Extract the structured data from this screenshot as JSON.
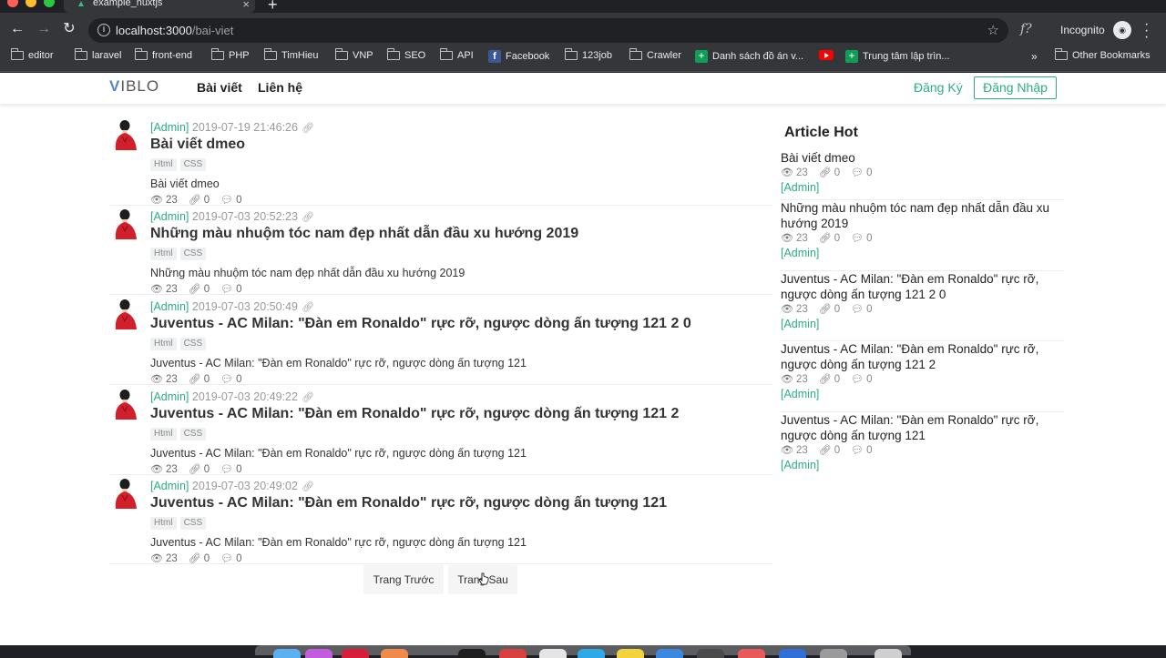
{
  "browser": {
    "tab_title": "example_nuxtjs",
    "url_host": "localhost:3000",
    "url_path": "/bai-viet",
    "profile_label": "Incognito",
    "extension_label": "f?",
    "bookmarks": [
      {
        "label": "editor",
        "icon": "folder-icon"
      },
      {
        "label": "laravel",
        "icon": "folder-icon"
      },
      {
        "label": "front-end",
        "icon": "folder-icon"
      },
      {
        "label": "PHP",
        "icon": "folder-icon"
      },
      {
        "label": "TimHieu",
        "icon": "folder-icon"
      },
      {
        "label": "VNP",
        "icon": "folder-icon"
      },
      {
        "label": "SEO",
        "icon": "folder-icon"
      },
      {
        "label": "API",
        "icon": "folder-icon"
      },
      {
        "label": "Facebook",
        "icon": "facebook-icon"
      },
      {
        "label": "123job",
        "icon": "folder-icon"
      },
      {
        "label": "Crawler",
        "icon": "folder-icon"
      },
      {
        "label": "Danh sách đồ án v...",
        "icon": "sheets-icon"
      },
      {
        "label": "",
        "icon": "youtube-icon"
      },
      {
        "label": "Trung tâm lập trìn...",
        "icon": "sheets-icon"
      }
    ],
    "more_label": "»",
    "other_bookmarks": "Other Bookmarks"
  },
  "site": {
    "logo": "VIBLO",
    "nav": [
      "Bài viết",
      "Liên hệ"
    ],
    "signup": "Đăng Ký",
    "login": "Đăng Nhập",
    "brand_color": "#2bae82"
  },
  "posts": [
    {
      "author": "[Admin]",
      "date": "2019-07-19 21:46:26",
      "title": "Bài viết dmeo",
      "tags": [
        "Html",
        "CSS"
      ],
      "excerpt": "Bài viết dmeo",
      "views": "23",
      "clips": "0",
      "comments": "0"
    },
    {
      "author": "[Admin]",
      "date": "2019-07-03 20:52:23",
      "title": "Những màu nhuộm tóc nam đẹp nhất dẫn đầu xu hướng 2019",
      "tags": [
        "Html",
        "CSS"
      ],
      "excerpt": "Những màu nhuộm tóc nam đẹp nhất dẫn đầu xu hướng 2019",
      "views": "23",
      "clips": "0",
      "comments": "0"
    },
    {
      "author": "[Admin]",
      "date": "2019-07-03 20:50:49",
      "title": "Juventus - AC Milan: \"Đàn em Ronaldo\" rực rỡ, ngược dòng ấn tượng 121 2 0",
      "tags": [
        "Html",
        "CSS"
      ],
      "excerpt": "Juventus - AC Milan: \"Đàn em Ronaldo\" rực rỡ, ngược dòng ấn tượng 121",
      "views": "23",
      "clips": "0",
      "comments": "0"
    },
    {
      "author": "[Admin]",
      "date": "2019-07-03 20:49:22",
      "title": "Juventus - AC Milan: \"Đàn em Ronaldo\" rực rỡ, ngược dòng ấn tượng 121 2",
      "tags": [
        "Html",
        "CSS"
      ],
      "excerpt": "Juventus - AC Milan: \"Đàn em Ronaldo\" rực rỡ, ngược dòng ấn tượng 121",
      "views": "23",
      "clips": "0",
      "comments": "0"
    },
    {
      "author": "[Admin]",
      "date": "2019-07-03 20:49:02",
      "title": "Juventus - AC Milan: \"Đàn em Ronaldo\" rực rỡ, ngược dòng ấn tượng 121",
      "tags": [
        "Html",
        "CSS"
      ],
      "excerpt": "Juventus - AC Milan: \"Đàn em Ronaldo\" rực rỡ, ngược dòng ấn tượng 121",
      "views": "23",
      "clips": "0",
      "comments": "0"
    }
  ],
  "pagination": {
    "prev": "Trang Trước",
    "next": "Trang Sau"
  },
  "sidebar": {
    "title": "Article Hot",
    "items": [
      {
        "title": "Bài viết dmeo",
        "views": "23",
        "clips": "0",
        "comments": "0",
        "author": "[Admin]"
      },
      {
        "title": "Những màu nhuộm tóc nam đẹp nhất dẫn đầu xu hướng 2019",
        "views": "23",
        "clips": "0",
        "comments": "0",
        "author": "[Admin]"
      },
      {
        "title": "Juventus - AC Milan: \"Đàn em Ronaldo\" rực rỡ, ngược dòng ấn tượng 121 2 0",
        "views": "23",
        "clips": "0",
        "comments": "0",
        "author": "[Admin]"
      },
      {
        "title": "Juventus - AC Milan: \"Đàn em Ronaldo\" rực rỡ, ngược dòng ấn tượng 121 2",
        "views": "23",
        "clips": "0",
        "comments": "0",
        "author": "[Admin]"
      },
      {
        "title": "Juventus - AC Milan: \"Đàn em Ronaldo\" rực rỡ, ngược dòng ấn tượng 121",
        "views": "23",
        "clips": "0",
        "comments": "0",
        "author": "[Admin]"
      }
    ]
  }
}
